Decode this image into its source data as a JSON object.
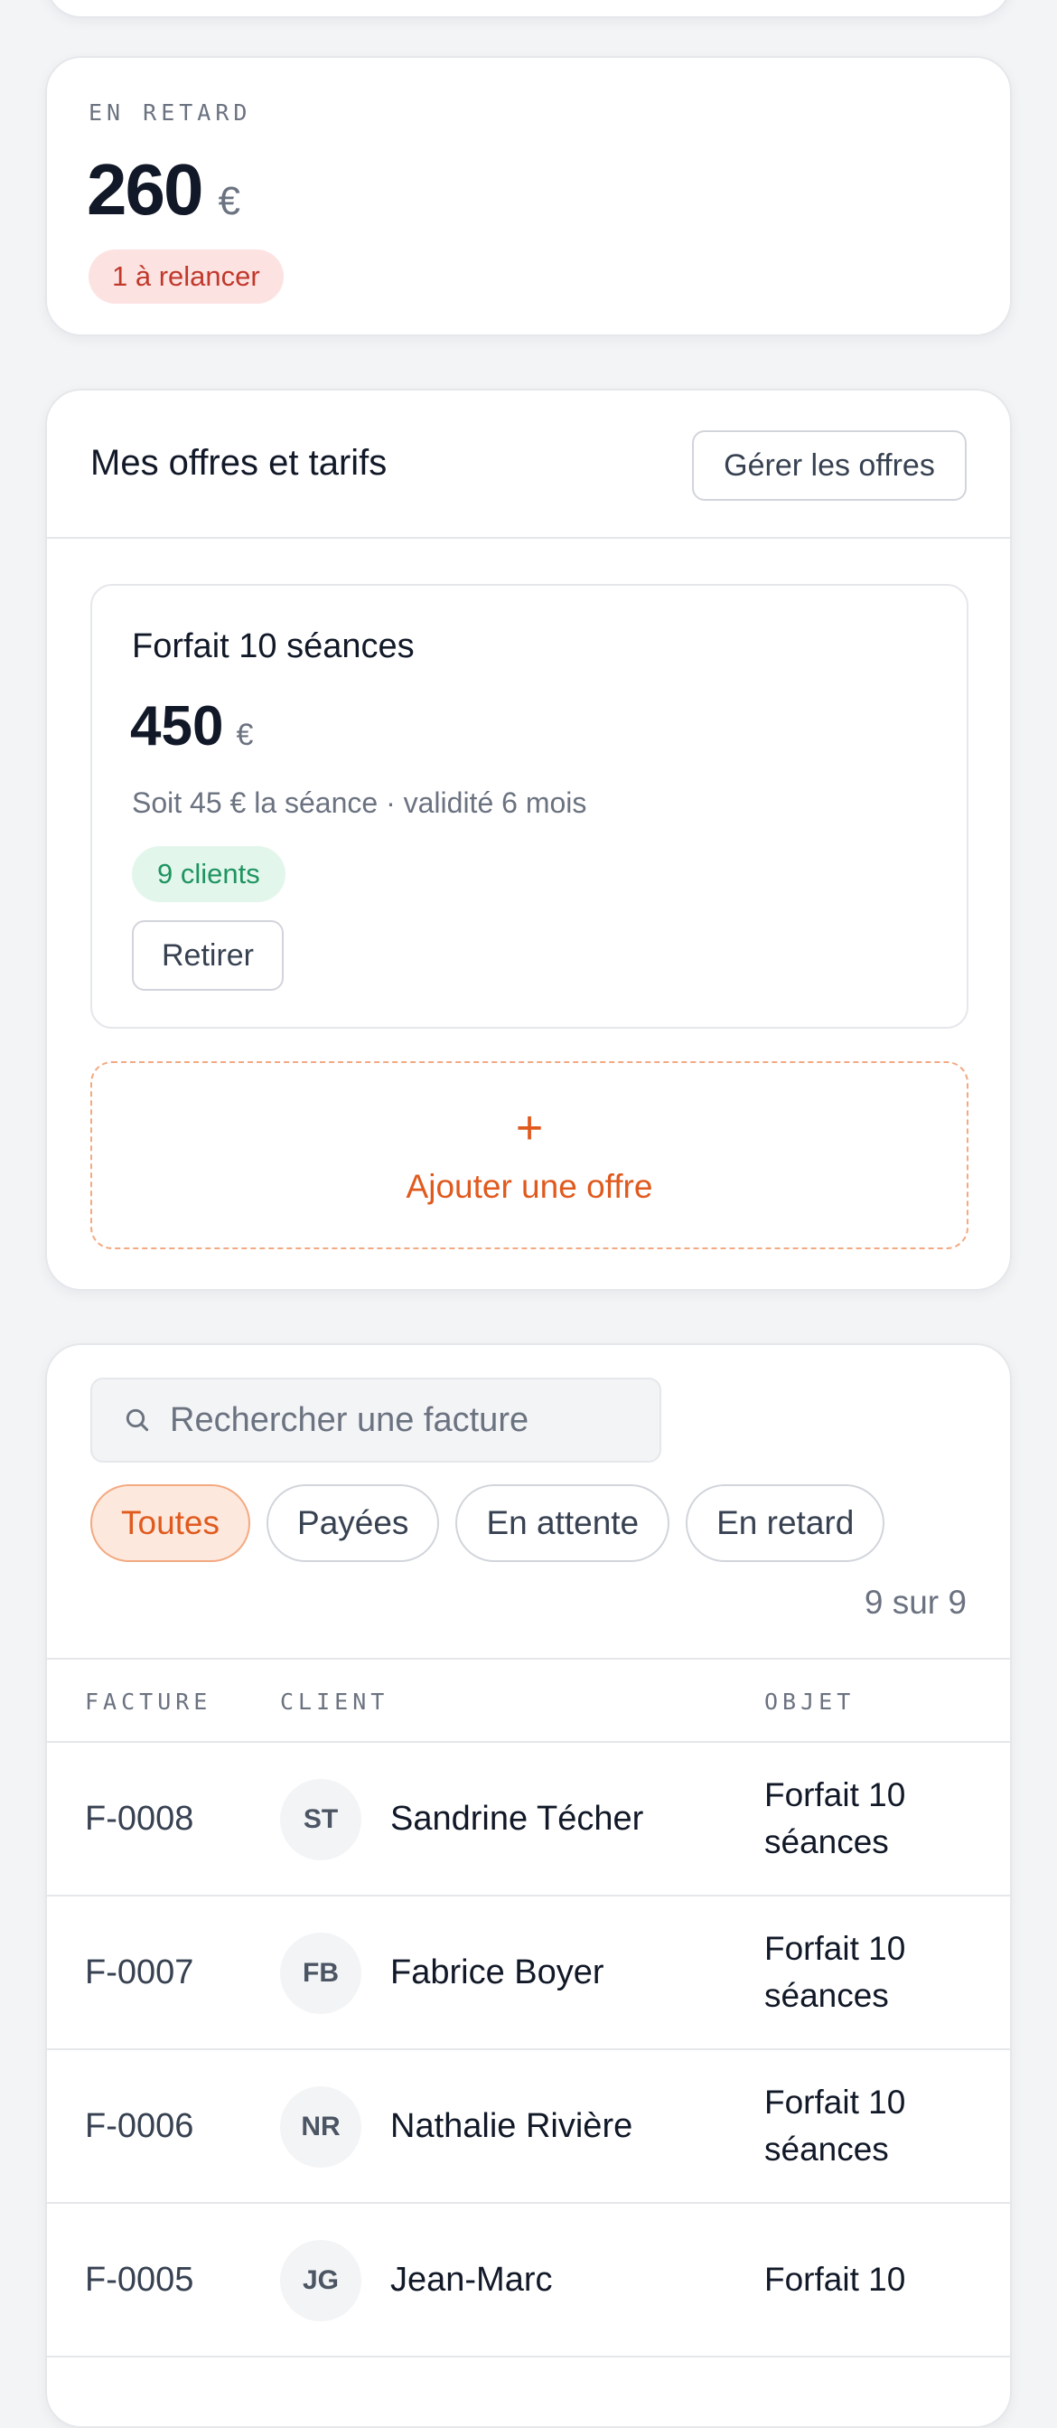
{
  "overdue": {
    "kicker": "EN RETARD",
    "amount": "260",
    "currency": "€",
    "badge": "1 à relancer"
  },
  "offers": {
    "title": "Mes offres et tarifs",
    "manage_label": "Gérer les offres",
    "items": [
      {
        "name": "Forfait 10 séances",
        "price": "450",
        "currency": "€",
        "description": "Soit 45 € la séance · validité 6 mois",
        "clients": "9 clients",
        "remove_label": "Retirer"
      }
    ],
    "add_icon": "+",
    "add_label": "Ajouter une offre"
  },
  "invoices": {
    "search_placeholder": "Rechercher une facture",
    "filters": [
      {
        "label": "Toutes",
        "active": true
      },
      {
        "label": "Payées",
        "active": false
      },
      {
        "label": "En attente",
        "active": false
      },
      {
        "label": "En retard",
        "active": false
      }
    ],
    "count": "9 sur 9",
    "columns": {
      "invoice": "FACTURE",
      "client": "CLIENT",
      "object": "OBJET"
    },
    "rows": [
      {
        "id": "F-0008",
        "initials": "ST",
        "client": "Sandrine Técher",
        "object": "Forfait 10 séances"
      },
      {
        "id": "F-0007",
        "initials": "FB",
        "client": "Fabrice Boyer",
        "object": "Forfait 10 séances"
      },
      {
        "id": "F-0006",
        "initials": "NR",
        "client": "Nathalie Rivière",
        "object": "Forfait 10 séances"
      },
      {
        "id": "F-0005",
        "initials": "JG",
        "client": "Jean-Marc",
        "object": "Forfait 10"
      }
    ]
  },
  "colors": {
    "accent": "#e05a1e",
    "danger": "#c0392b",
    "success": "#1f9460"
  }
}
